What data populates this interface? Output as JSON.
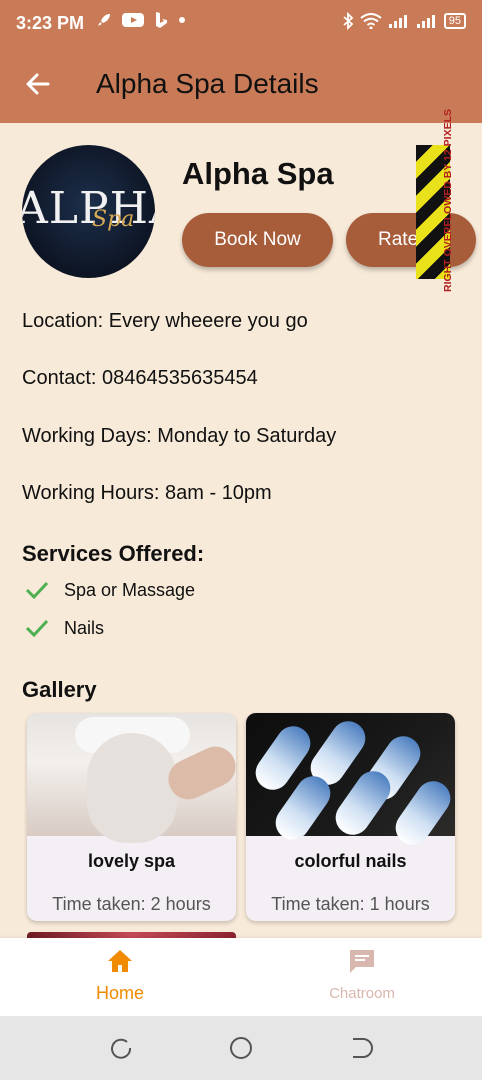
{
  "status_bar": {
    "time": "3:23 PM",
    "battery": "95"
  },
  "app_bar": {
    "title": "Alpha Spa Details"
  },
  "spa": {
    "name": "Alpha Spa",
    "logo_text": "ALPHA",
    "logo_subtext": "Spa",
    "book_label": "Book Now",
    "rate_label": "Rate Us"
  },
  "debug": {
    "overflow_text": "RIGHT OVERFLOWED BY 12 PIXELS"
  },
  "details": {
    "location": "Location: Every wheeere you go",
    "contact": "Contact: 08464535635454",
    "working_days": "Working Days: Monday to Saturday",
    "working_hours": "Working Hours: 8am - 10pm"
  },
  "services": {
    "heading": "Services Offered:",
    "items": [
      "Spa or Massage",
      "Nails"
    ]
  },
  "gallery": {
    "heading": "Gallery",
    "items": [
      {
        "title": "lovely spa",
        "time": "Time taken: 2 hours"
      },
      {
        "title": "colorful nails",
        "time": "Time taken: 1 hours"
      }
    ]
  },
  "bottom_nav": {
    "items": [
      {
        "label": "Home",
        "icon": "home-icon",
        "active": true
      },
      {
        "label": "Chatroom",
        "icon": "chat-icon",
        "active": false
      }
    ]
  },
  "colors": {
    "app_bar": "#c97b57",
    "background": "#f8ead9",
    "button": "#a75c3a",
    "active_nav": "#f08a00",
    "check": "#4caf50"
  }
}
